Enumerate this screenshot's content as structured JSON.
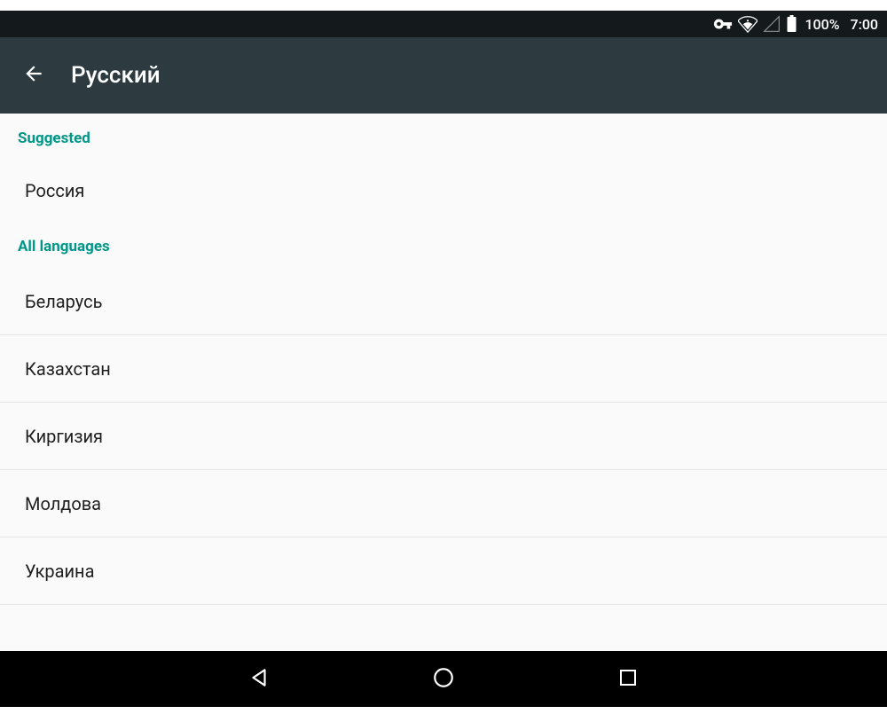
{
  "status_bar": {
    "battery_pct": "100%",
    "clock": "7:00"
  },
  "action_bar": {
    "title": "Русский"
  },
  "sections": {
    "suggested": {
      "header": "Suggested",
      "items": [
        {
          "label": "Россия"
        }
      ]
    },
    "all": {
      "header": "All languages",
      "items": [
        {
          "label": "Беларусь"
        },
        {
          "label": "Казахстан"
        },
        {
          "label": "Киргизия"
        },
        {
          "label": "Молдова"
        },
        {
          "label": "Украина"
        }
      ]
    }
  },
  "colors": {
    "accent": "#009688",
    "action_bar_bg": "#2d3a40",
    "status_bar_bg": "#14191c"
  }
}
